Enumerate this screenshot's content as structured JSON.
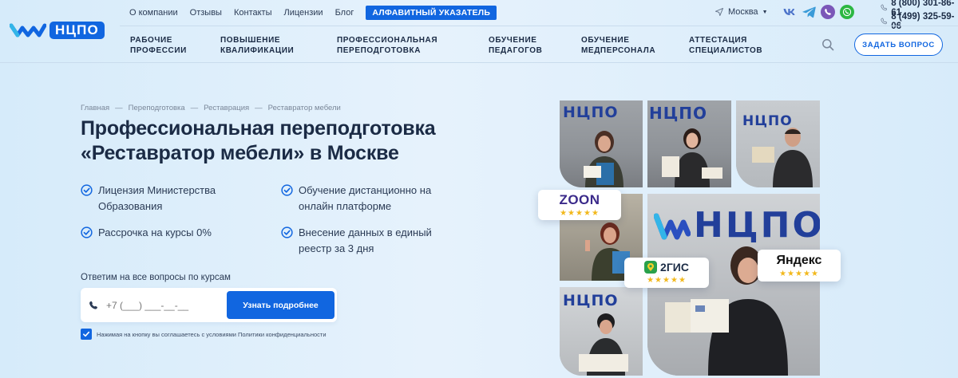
{
  "logo": {
    "text": "НЦПО"
  },
  "topnav": [
    {
      "label": "О компании"
    },
    {
      "label": "Отзывы"
    },
    {
      "label": "Контакты"
    },
    {
      "label": "Лицензии"
    },
    {
      "label": "Блог"
    }
  ],
  "alphabet_button": "АЛФАВИТНЫЙ УКАЗАТЕЛЬ",
  "city": "Москва",
  "socials": [
    "vk-icon",
    "telegram-icon",
    "viber-icon",
    "whatsapp-icon"
  ],
  "phones": [
    "8 (800) 301-86-61",
    "8 (499) 325-59-06"
  ],
  "mainnav": [
    {
      "line1": "РАБОЧИЕ",
      "line2": "ПРОФЕССИИ"
    },
    {
      "line1": "ПОВЫШЕНИЕ",
      "line2": "КВАЛИФИКАЦИИ"
    },
    {
      "line1": "ПРОФЕССИОНАЛЬНАЯ",
      "line2": "ПЕРЕПОДГОТОВКА"
    },
    {
      "line1": "ОБУЧЕНИЕ",
      "line2": "ПЕДАГОГОВ"
    },
    {
      "line1": "ОБУЧЕНИЕ",
      "line2": "МЕДПЕРСОНАЛА"
    },
    {
      "line1": "АТТЕСТАЦИЯ",
      "line2": "СПЕЦИАЛИСТОВ"
    }
  ],
  "ask_button": "ЗАДАТЬ ВОПРОС",
  "breadcrumbs": [
    "Главная",
    "—",
    "Переподготовка",
    "—",
    "Реставрация",
    "—",
    "Реставратор мебели"
  ],
  "title": "Профессиональная переподготовка «Реставратор мебели» в Москве",
  "features": [
    {
      "line1": "Лицензия Министерства",
      "line2": "Образования"
    },
    {
      "line1": "Обучение дистанционно на",
      "line2": "онлайн платформе"
    },
    {
      "line1": "Рассрочка на курсы 0%",
      "line2": ""
    },
    {
      "line1": "Внесение данных в единый",
      "line2": "реестр за 3 дня"
    }
  ],
  "form": {
    "label": "Ответим на все вопросы по курсам",
    "placeholder": "+7 (___) ___-__-__",
    "button": "Узнать подробнее",
    "agreement": "Нажимая на кнопку вы соглашаетесь с условиями Политики конфиденциальности"
  },
  "reviews": [
    {
      "name": "ZOON",
      "stars": "★★★★★"
    },
    {
      "name": "2ГИС",
      "stars": "★★★★★"
    },
    {
      "name": "Яндекс",
      "stars": "★★★★★"
    }
  ],
  "tile_brand": "НЦПО",
  "colors": {
    "accent": "#1166e0",
    "text": "#1b2b45",
    "star": "#f2b81c"
  }
}
